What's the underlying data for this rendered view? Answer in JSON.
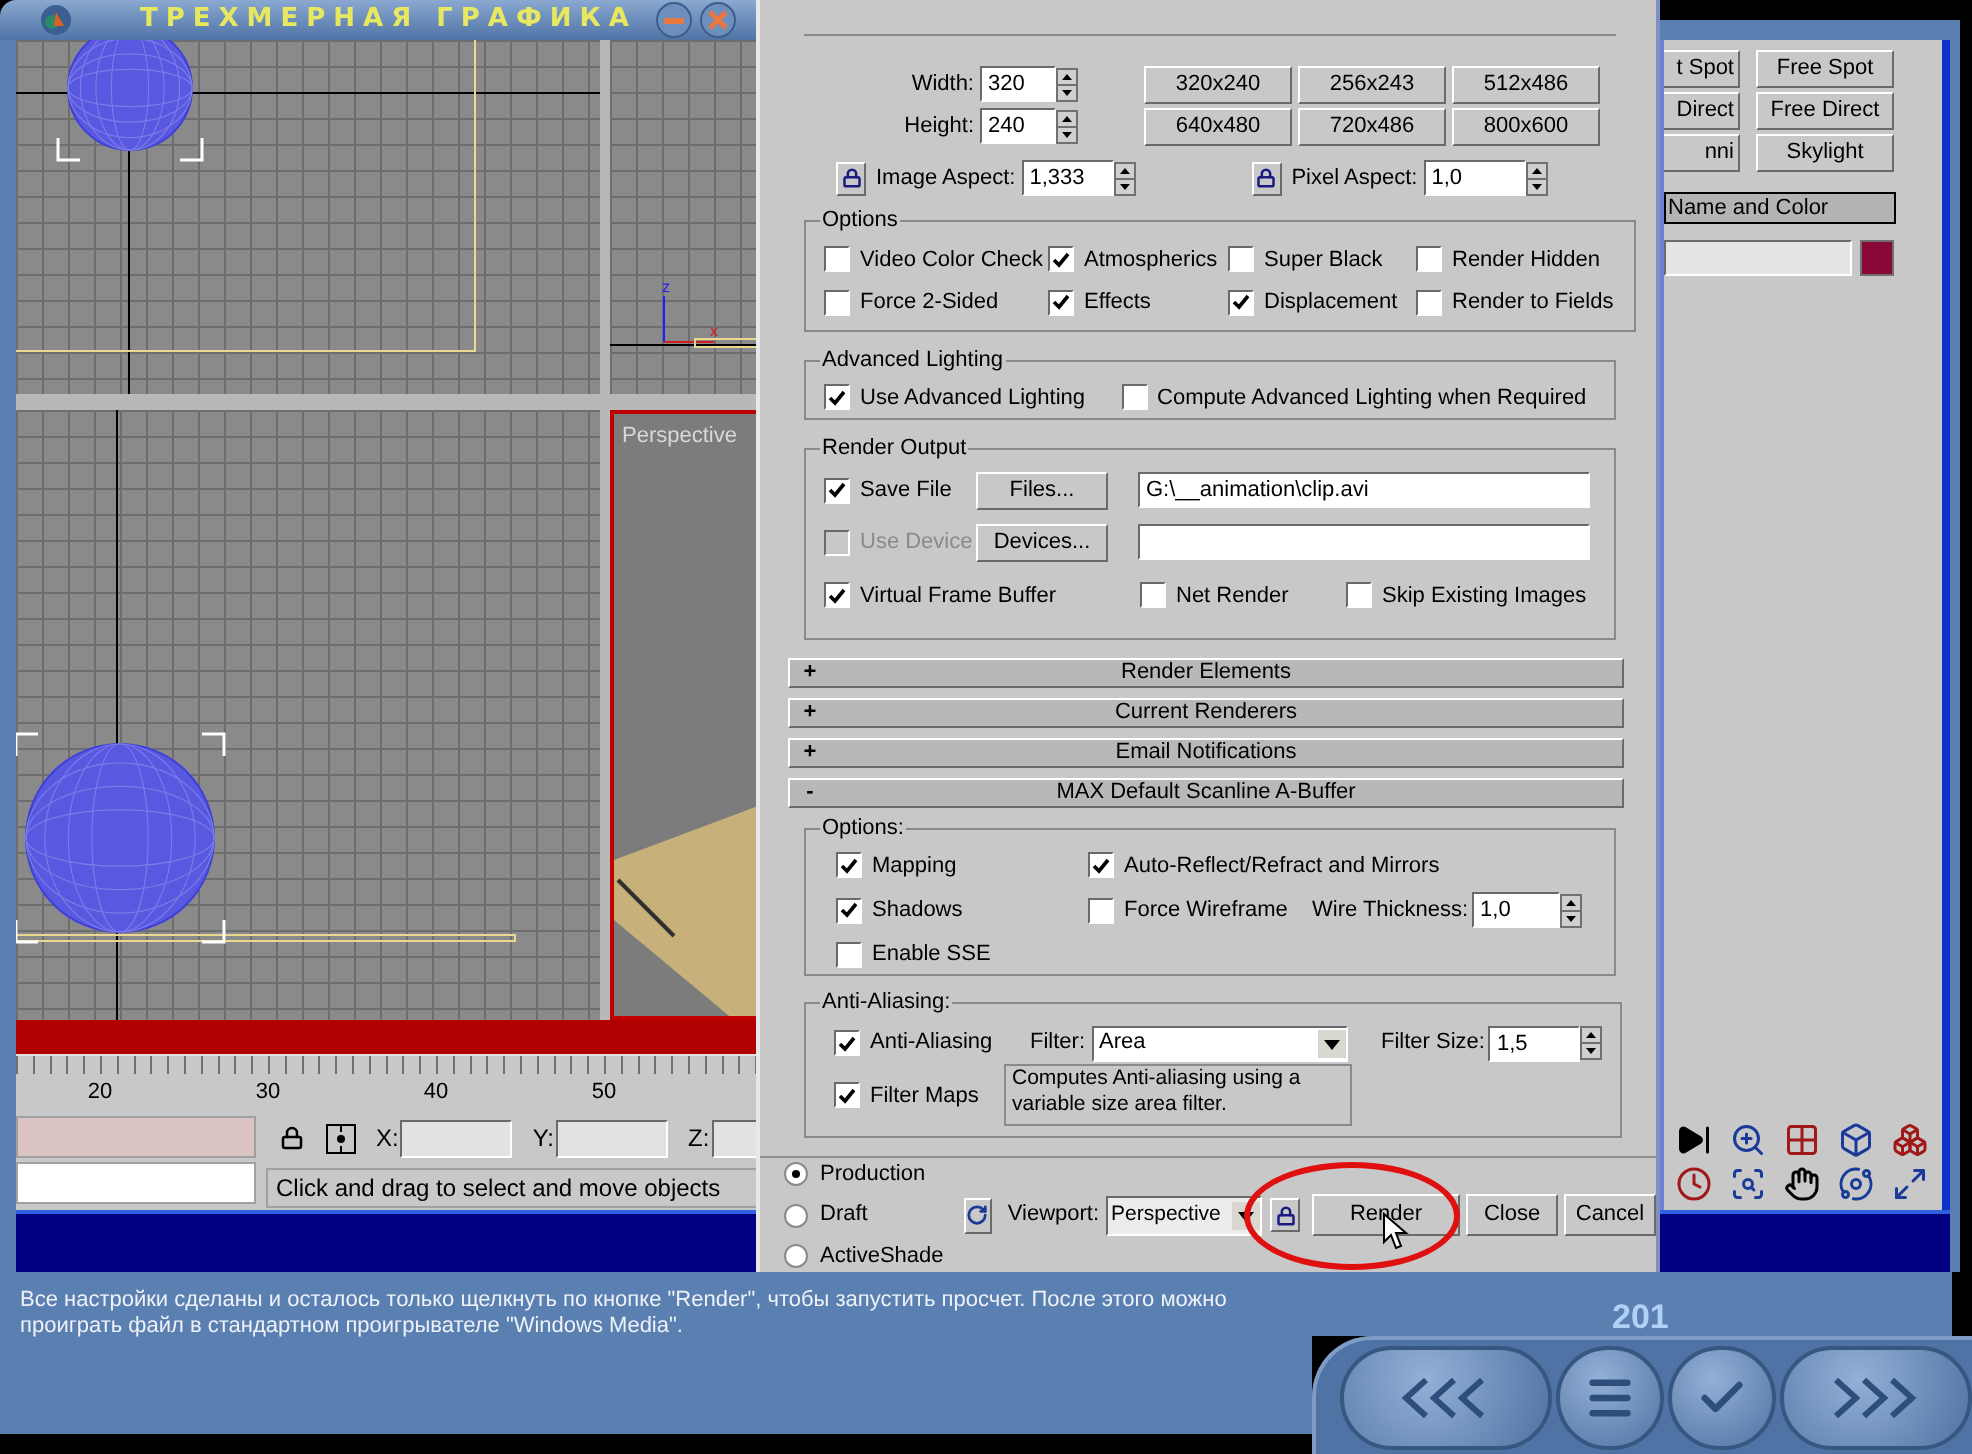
{
  "title_bar": {
    "title": "ТРЕХМЕРНАЯ ГРАФИКА"
  },
  "perspective_viewport": {
    "label": "Perspective",
    "active": true
  },
  "axis_labels": [
    "z",
    "x"
  ],
  "timeline": {
    "labels": [
      "20",
      "30",
      "40",
      "50"
    ]
  },
  "coordinates": [
    {
      "label": "X:"
    },
    {
      "label": "Y:"
    },
    {
      "label": "Z:"
    }
  ],
  "status_prompt": "Click and drag to select and move objects",
  "command_panel": {
    "object_buttons": [
      {
        "label": "t Spot"
      },
      {
        "label": "Free Spot"
      },
      {
        "label": "Direct"
      },
      {
        "label": "Free Direct"
      },
      {
        "label": "nni"
      },
      {
        "label": "Skylight"
      }
    ],
    "rollout_title": "Name and Color"
  },
  "render_dialog": {
    "width": {
      "label": "Width:",
      "value": "320"
    },
    "height": {
      "label": "Height:",
      "value": "240"
    },
    "presets": [
      "320x240",
      "256x243",
      "512x486",
      "640x480",
      "720x486",
      "800x600"
    ],
    "image_aspect": {
      "label": "Image Aspect:",
      "value": "1,333"
    },
    "pixel_aspect": {
      "label": "Pixel Aspect:",
      "value": "1,0"
    },
    "options": {
      "title": "Options",
      "items": [
        {
          "label": "Video Color Check",
          "checked": false
        },
        {
          "label": "Atmospherics",
          "checked": true
        },
        {
          "label": "Super Black",
          "checked": false
        },
        {
          "label": "Render Hidden",
          "checked": false
        },
        {
          "label": "Force 2-Sided",
          "checked": false
        },
        {
          "label": "Effects",
          "checked": true
        },
        {
          "label": "Displacement",
          "checked": true
        },
        {
          "label": "Render to Fields",
          "checked": false
        }
      ]
    },
    "advanced_lighting": {
      "title": "Advanced Lighting",
      "items": [
        {
          "label": "Use Advanced Lighting",
          "checked": true
        },
        {
          "label": "Compute Advanced Lighting when Required",
          "checked": false
        }
      ]
    },
    "render_output": {
      "title": "Render Output",
      "save_file": {
        "label": "Save File",
        "checked": true,
        "disabled": false
      },
      "files_button": "Files...",
      "path": "G:\\__animation\\clip.avi",
      "use_device": {
        "label": "Use Device",
        "checked": false,
        "disabled": true
      },
      "devices_button": "Devices...",
      "bottom_checks": [
        {
          "label": "Virtual Frame Buffer",
          "checked": true,
          "disabled": false
        },
        {
          "label": "Net Render",
          "checked": false,
          "disabled": false
        },
        {
          "label": "Skip Existing Images",
          "checked": false,
          "disabled": false
        }
      ]
    },
    "rollouts": [
      {
        "sign": "+",
        "title": "Render Elements"
      },
      {
        "sign": "+",
        "title": "Current Renderers"
      },
      {
        "sign": "+",
        "title": "Email Notifications"
      },
      {
        "sign": "-",
        "title": "MAX Default Scanline A-Buffer"
      }
    ],
    "scanline_options": {
      "title": "Options:",
      "items": [
        {
          "label": "Mapping",
          "checked": true
        },
        {
          "label": "Auto-Reflect/Refract and Mirrors",
          "checked": true
        },
        {
          "label": "Shadows",
          "checked": true
        },
        {
          "label": "Force Wireframe",
          "checked": false
        },
        {
          "label": "Enable SSE",
          "checked": false
        }
      ],
      "wire_thickness": {
        "label": "Wire Thickness:",
        "value": "1,0"
      }
    },
    "anti_aliasing": {
      "title": "Anti-Aliasing:",
      "anti_aliasing": {
        "label": "Anti-Aliasing",
        "checked": true
      },
      "filter": {
        "label": "Filter:",
        "value": "Area"
      },
      "filter_size": {
        "label": "Filter Size:",
        "value": "1,5"
      },
      "filter_maps": {
        "label": "Filter Maps",
        "checked": true
      },
      "description": "Computes Anti-aliasing using a variable size area filter."
    },
    "render_modes": [
      {
        "label": "Production",
        "selected": true
      },
      {
        "label": "Draft",
        "selected": false
      },
      {
        "label": "ActiveShade",
        "selected": false
      }
    ],
    "viewport": {
      "label": "Viewport:",
      "value": "Perspective"
    },
    "buttons": [
      "Render",
      "Close",
      "Cancel"
    ]
  },
  "instruction": "Все настройки сделаны и осталось только щелкнуть по кнопке \"Render\", чтобы запустить просчет. После этого можно проиграть файл в стандартном проигрывателе \"Windows Media\".",
  "page_number": "201"
}
